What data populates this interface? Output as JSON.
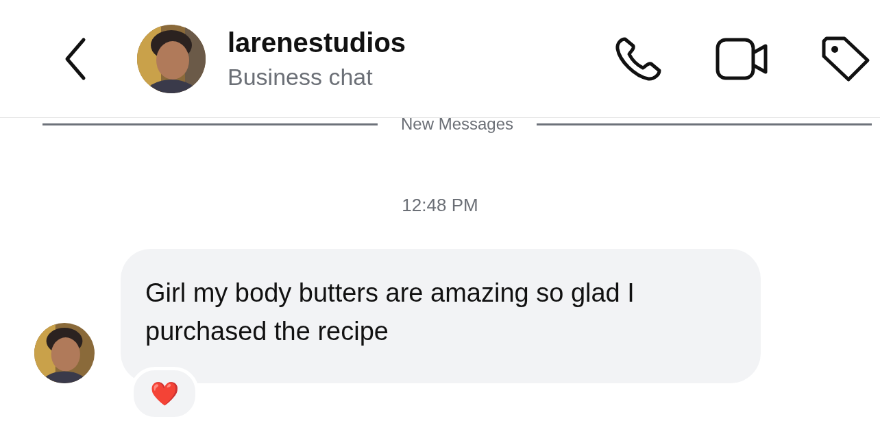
{
  "header": {
    "name": "larenestudios",
    "subtitle": "Business chat"
  },
  "divider": {
    "label": "New Messages"
  },
  "timestamp": "12:48 PM",
  "messages": [
    {
      "text": "Girl my body butters are amazing so glad I purchased the recipe",
      "reaction": "❤️"
    }
  ]
}
